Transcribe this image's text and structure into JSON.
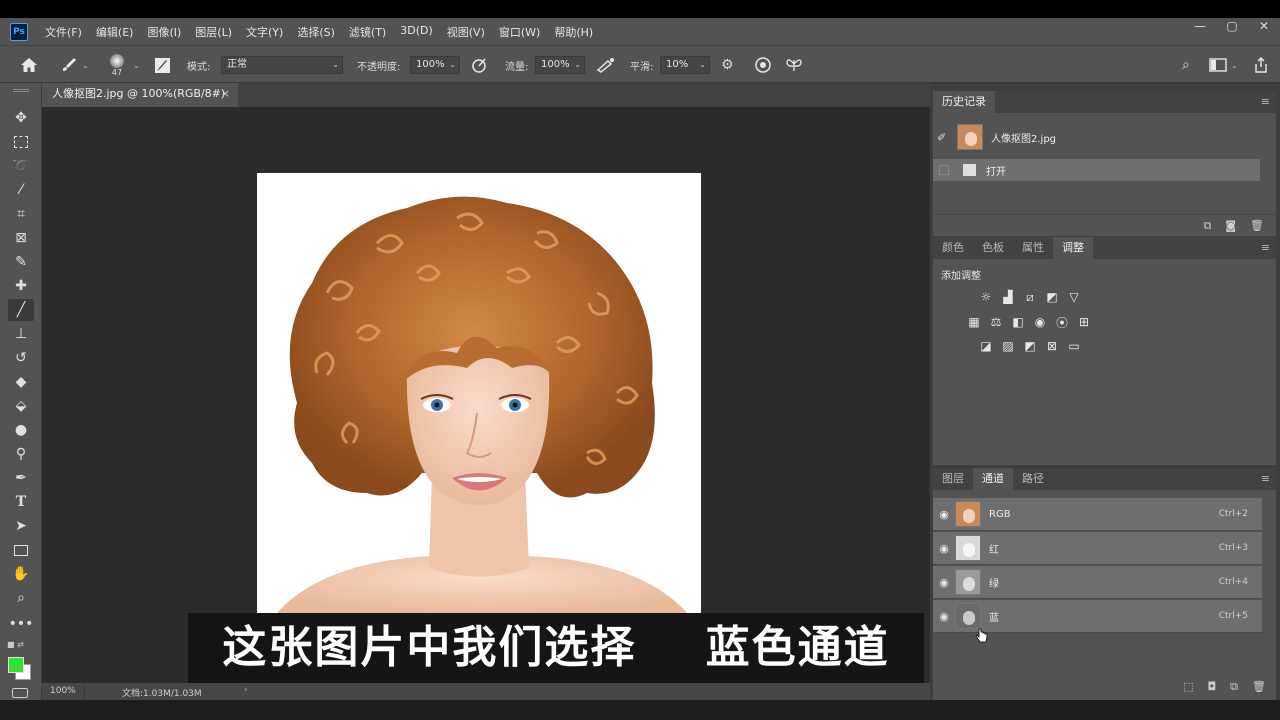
{
  "app": {
    "logo": "Ps"
  },
  "menu": [
    "文件(F)",
    "编辑(E)",
    "图像(I)",
    "图层(L)",
    "文字(Y)",
    "选择(S)",
    "滤镜(T)",
    "3D(D)",
    "视图(V)",
    "窗口(W)",
    "帮助(H)"
  ],
  "window_controls": {
    "minimize": "—",
    "restore": "▢",
    "close": "✕"
  },
  "options": {
    "brush_size": "47",
    "mode_label": "模式:",
    "mode_value": "正常",
    "opacity_label": "不透明度:",
    "opacity_value": "100%",
    "flow_label": "流量:",
    "flow_value": "100%",
    "smoothing_label": "平滑:",
    "smoothing_value": "10%"
  },
  "document": {
    "tab_title": "人像抠图2.jpg @ 100%(RGB/8#)",
    "close_glyph": "×",
    "zoom": "100%",
    "doc_info": "文档:1.03M/1.03M"
  },
  "subtitle": "这张图片中我们选择    蓝色通道",
  "history": {
    "tab": "历史记录",
    "snapshot_name": "人像抠图2.jpg",
    "items": [
      {
        "label": "打开"
      }
    ]
  },
  "adjust_panel": {
    "tabs": [
      "颜色",
      "色板",
      "属性",
      "调整"
    ],
    "active_tab": "调整",
    "add_label": "添加调整"
  },
  "channels_panel": {
    "tabs": [
      "图层",
      "通道",
      "路径"
    ],
    "active_tab": "通道",
    "channels": [
      {
        "name": "RGB",
        "shortcut": "Ctrl+2"
      },
      {
        "name": "红",
        "shortcut": "Ctrl+3"
      },
      {
        "name": "绿",
        "shortcut": "Ctrl+4"
      },
      {
        "name": "蓝",
        "shortcut": "Ctrl+5"
      }
    ]
  },
  "colors": {
    "foreground": "#35e035",
    "background": "#ffffff",
    "panel_bg": "#535353",
    "canvas_bg": "#2c2c2b"
  },
  "tools": [
    "move-tool",
    "marquee-tool",
    "lasso-tool",
    "magic-wand-tool",
    "crop-tool",
    "frame-tool",
    "eyedropper-tool",
    "healing-tool",
    "brush-tool",
    "stamp-tool",
    "history-brush-tool",
    "eraser-tool",
    "gradient-tool",
    "blur-tool",
    "dodge-tool",
    "pen-tool",
    "type-tool",
    "path-select-tool",
    "rectangle-tool",
    "hand-tool",
    "zoom-tool",
    "more-tools"
  ]
}
